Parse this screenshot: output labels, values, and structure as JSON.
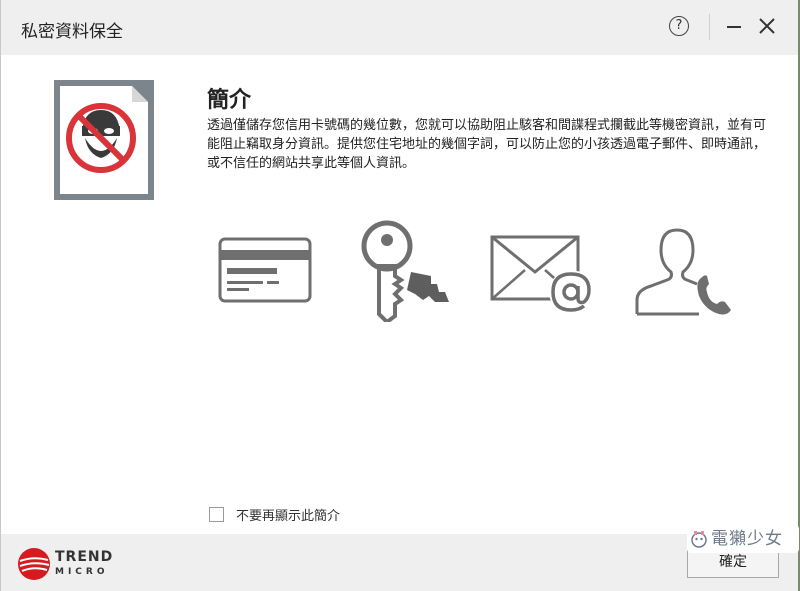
{
  "window": {
    "title": "私密資料保全",
    "help_symbol": "?"
  },
  "intro": {
    "heading": "簡介",
    "description": "透過僅儲存您信用卡號碼的幾位數，您就可以協助阻止駭客和間諜程式攔截此等機密資訊，並有可能阻止竊取身分資訊。提供您住宅地址的幾個字詞，可以防止您的小孩透過電子郵件、即時通訊，或不信任的網站共享此等個人資訊。"
  },
  "features": {
    "icons": [
      "credit-card-icon",
      "key-icon",
      "email-icon",
      "contact-phone-icon"
    ]
  },
  "dont_show_again": {
    "label": "不要再顯示此簡介",
    "checked": false
  },
  "footer": {
    "logo_line1": "TREND",
    "logo_line2": "MICRO",
    "ok_label": "確定"
  },
  "watermark": {
    "text": "電獺少女"
  },
  "colors": {
    "icon_gray": "#6f6f6f",
    "ban_red": "#d9343a",
    "brand_red": "#d71920",
    "titlebar_bg": "#efefef"
  }
}
